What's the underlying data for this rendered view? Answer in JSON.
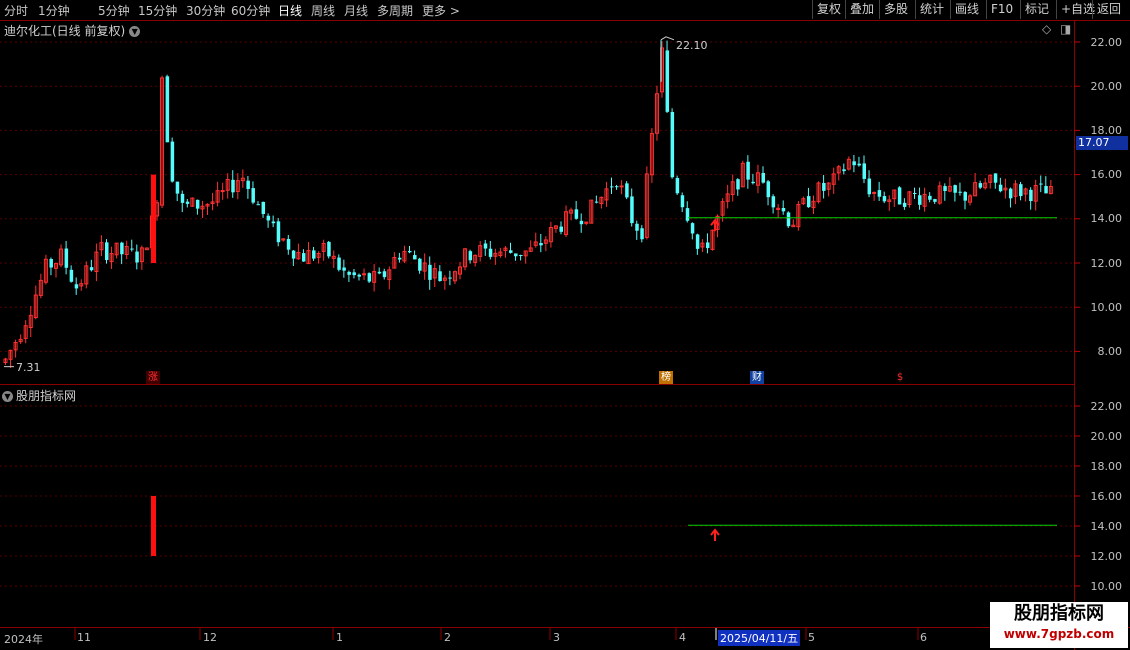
{
  "toolbar": {
    "periods": [
      "分时",
      "1分钟",
      "5分钟",
      "15分钟",
      "30分钟",
      "60分钟",
      "日线",
      "周线",
      "月线",
      "多周期",
      "更多 >"
    ],
    "active": "日线",
    "buttons": [
      "复权",
      "叠加",
      "多股",
      "统计",
      "画线",
      "F10",
      "标记",
      "+自选",
      "返回"
    ]
  },
  "main_panel": {
    "title": "迪尔化工(日线 前复权)",
    "high_label": "22.10",
    "low_label": "7.31",
    "current_price": "17.07",
    "axis": [
      "22.00",
      "20.00",
      "18.00",
      "16.00",
      "14.00",
      "12.00",
      "10.00",
      "8.00"
    ],
    "markers": [
      {
        "text": "涨",
        "color": "#ff3030",
        "bg": "#400000"
      },
      {
        "text": "榜",
        "color": "#ffffff",
        "bg": "#c07000"
      },
      {
        "text": "财",
        "color": "#ffffff",
        "bg": "#1040a0"
      },
      {
        "text": "$",
        "color": "#ff3030",
        "bg": "#000000"
      }
    ]
  },
  "sub_panel": {
    "title": "股朋指标网",
    "axis": [
      "22.00",
      "20.00",
      "18.00",
      "16.00",
      "14.00",
      "12.00",
      "10.00"
    ]
  },
  "date_axis": {
    "labels": [
      "2024年",
      "11",
      "12",
      "1",
      "2",
      "3",
      "4",
      "5",
      "6"
    ],
    "cursor_date": "2025/04/11/五"
  },
  "watermark": {
    "line1": "股朋指标网",
    "line2": "www.7gpzb.com"
  },
  "colors": {
    "up": "#ff3030",
    "down": "#54fcfc",
    "support": "#00d000",
    "grid": "#5a0000"
  }
}
